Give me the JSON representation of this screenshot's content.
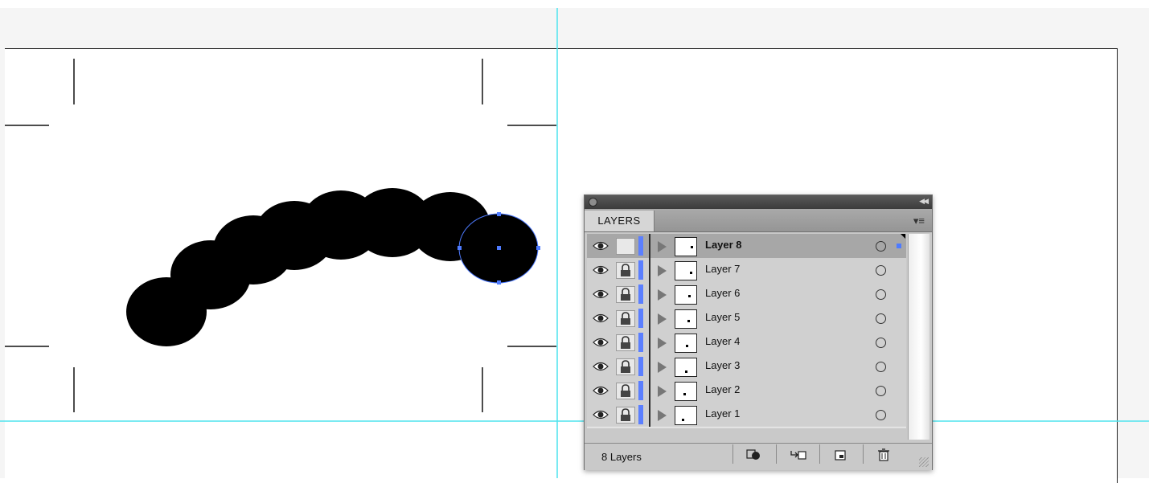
{
  "panel": {
    "tab_label": "LAYERS",
    "collapse_icon": "double-chevron-left-icon",
    "menu_icon": "panel-menu-icon",
    "footer_count": "8 Layers",
    "layers": [
      {
        "label": "Layer 8",
        "selected": true,
        "locked": false
      },
      {
        "label": "Layer 7",
        "selected": false,
        "locked": true
      },
      {
        "label": "Layer 6",
        "selected": false,
        "locked": true
      },
      {
        "label": "Layer 5",
        "selected": false,
        "locked": true
      },
      {
        "label": "Layer 4",
        "selected": false,
        "locked": true
      },
      {
        "label": "Layer 3",
        "selected": false,
        "locked": true
      },
      {
        "label": "Layer 2",
        "selected": false,
        "locked": true
      },
      {
        "label": "Layer 1",
        "selected": false,
        "locked": true
      }
    ],
    "footer_buttons": [
      "make-clipping-mask-icon",
      "create-sublayer-icon",
      "new-layer-icon",
      "trash-icon"
    ]
  },
  "colors": {
    "guide": "#4fe3ee",
    "layer_color": "#5b7fff",
    "selection": "#4e7bff"
  }
}
